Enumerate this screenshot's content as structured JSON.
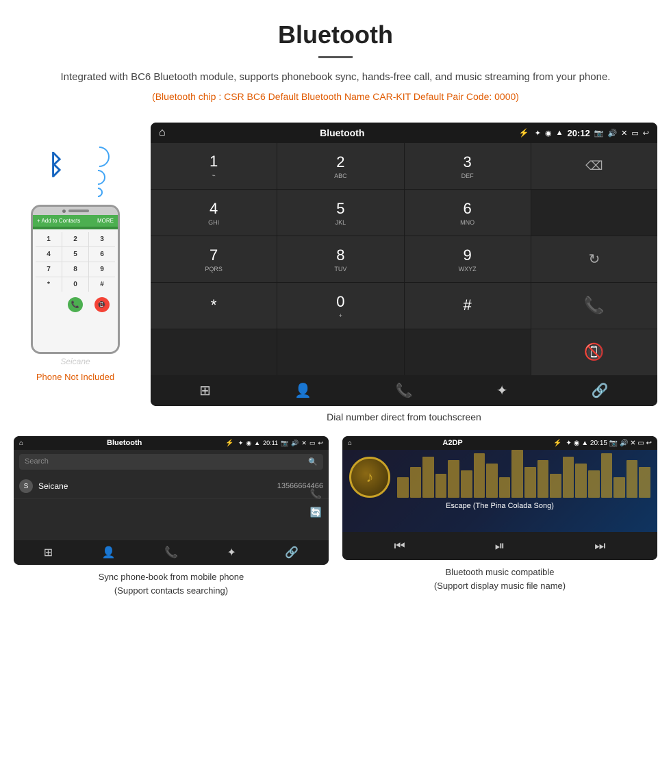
{
  "header": {
    "title": "Bluetooth",
    "description": "Integrated with BC6 Bluetooth module, supports phonebook sync, hands-free call, and music streaming from your phone.",
    "specs": "(Bluetooth chip : CSR BC6    Default Bluetooth Name CAR-KIT    Default Pair Code: 0000)"
  },
  "phone_section": {
    "not_included_label": "Phone Not Included",
    "watermark": "Seicane"
  },
  "car_screen": {
    "status_bar": {
      "title": "Bluetooth",
      "time": "20:12",
      "usb_icon": "⚡",
      "bt_icon": "✦",
      "location_icon": "◉",
      "signal_icon": "▲"
    },
    "dialpad": [
      {
        "num": "1",
        "sub": "⌁"
      },
      {
        "num": "2",
        "sub": "ABC"
      },
      {
        "num": "3",
        "sub": "DEF"
      },
      {
        "num": "",
        "sub": "",
        "type": "backspace"
      },
      {
        "num": "4",
        "sub": "GHI"
      },
      {
        "num": "5",
        "sub": "JKL"
      },
      {
        "num": "6",
        "sub": "MNO"
      },
      {
        "num": "",
        "sub": "",
        "type": "empty"
      },
      {
        "num": "7",
        "sub": "PQRS"
      },
      {
        "num": "8",
        "sub": "TUV"
      },
      {
        "num": "9",
        "sub": "WXYZ"
      },
      {
        "num": "",
        "sub": "",
        "type": "refresh"
      },
      {
        "num": "*",
        "sub": ""
      },
      {
        "num": "0",
        "sub": "+"
      },
      {
        "num": "#",
        "sub": ""
      },
      {
        "num": "",
        "sub": "",
        "type": "call-green"
      },
      {
        "num": "",
        "sub": "",
        "type": "empty"
      },
      {
        "num": "",
        "sub": "",
        "type": "empty"
      },
      {
        "num": "",
        "sub": "",
        "type": "empty"
      },
      {
        "num": "",
        "sub": "",
        "type": "call-red"
      }
    ],
    "bottom_nav": [
      "⊞",
      "👤",
      "📞",
      "✦",
      "🔗"
    ],
    "caption": "Dial number direct from touchscreen"
  },
  "phonebook_screen": {
    "status_bar": {
      "title": "Bluetooth",
      "time": "20:11"
    },
    "search_placeholder": "Search",
    "contacts": [
      {
        "letter": "S",
        "name": "Seicane",
        "number": "13566664466"
      }
    ],
    "caption": "Sync phone-book from mobile phone\n(Support contacts searching)"
  },
  "music_screen": {
    "status_bar": {
      "title": "A2DP",
      "time": "20:15"
    },
    "song_title": "Escape (The Pina Colada Song)",
    "viz_bars": [
      30,
      45,
      60,
      35,
      55,
      40,
      65,
      50,
      30,
      70,
      45,
      55,
      35,
      60,
      50,
      40,
      65,
      30,
      55,
      45
    ],
    "caption": "Bluetooth music compatible\n(Support display music file name)"
  }
}
